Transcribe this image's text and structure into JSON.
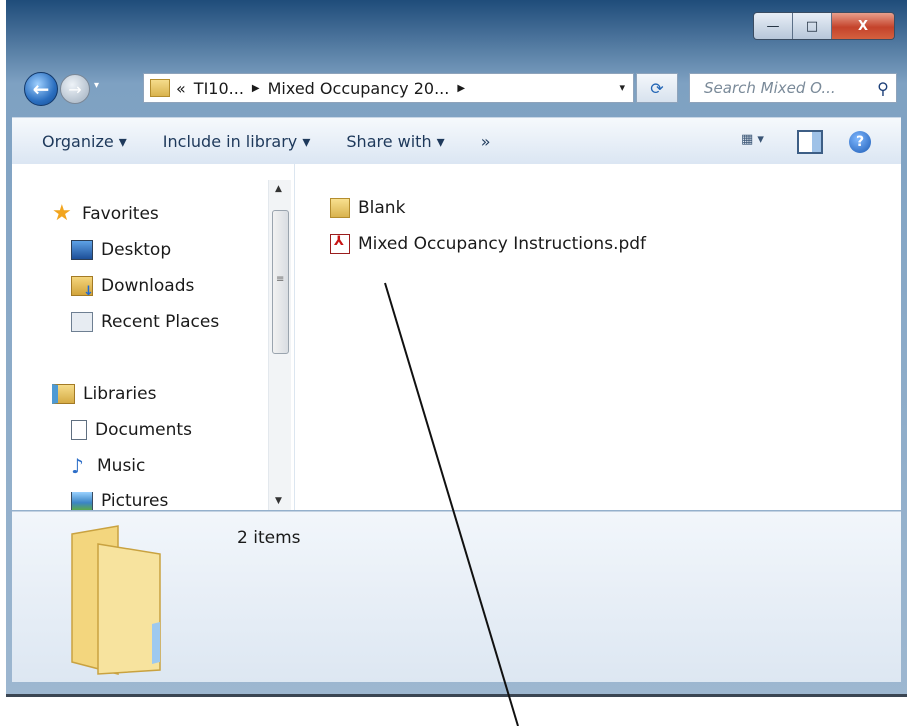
{
  "window": {
    "caption_buttons": {
      "minimize": "—",
      "maximize": "□",
      "close": "X"
    }
  },
  "navigation": {
    "back_glyph": "←",
    "forward_glyph": "→",
    "address": {
      "overflow": "«",
      "segments": [
        "TI10...",
        "Mixed Occupancy 20..."
      ],
      "separator": "▶",
      "dropdown": "▾"
    },
    "refresh_glyph": "⟳",
    "search_placeholder": "Search Mixed O...",
    "search_glyph": "⚲"
  },
  "commandbar": {
    "items": [
      "Organize ▾",
      "Include in library ▾",
      "Share with ▾",
      "»"
    ],
    "views_label": "▦ ▾",
    "help_glyph": "?"
  },
  "navpane": {
    "favorites": {
      "label": "Favorites",
      "items": [
        "Desktop",
        "Downloads",
        "Recent Places"
      ]
    },
    "libraries": {
      "label": "Libraries",
      "items": [
        "Documents",
        "Music",
        "Pictures"
      ]
    }
  },
  "files": [
    {
      "name": "Blank",
      "type": "folder"
    },
    {
      "name": "Mixed Occupancy Instructions.pdf",
      "type": "pdf"
    }
  ],
  "details": {
    "count": "2 items"
  },
  "colors": {
    "accent": "#2b6fc0",
    "close": "#c4432b",
    "folder": "#e8c35e"
  }
}
